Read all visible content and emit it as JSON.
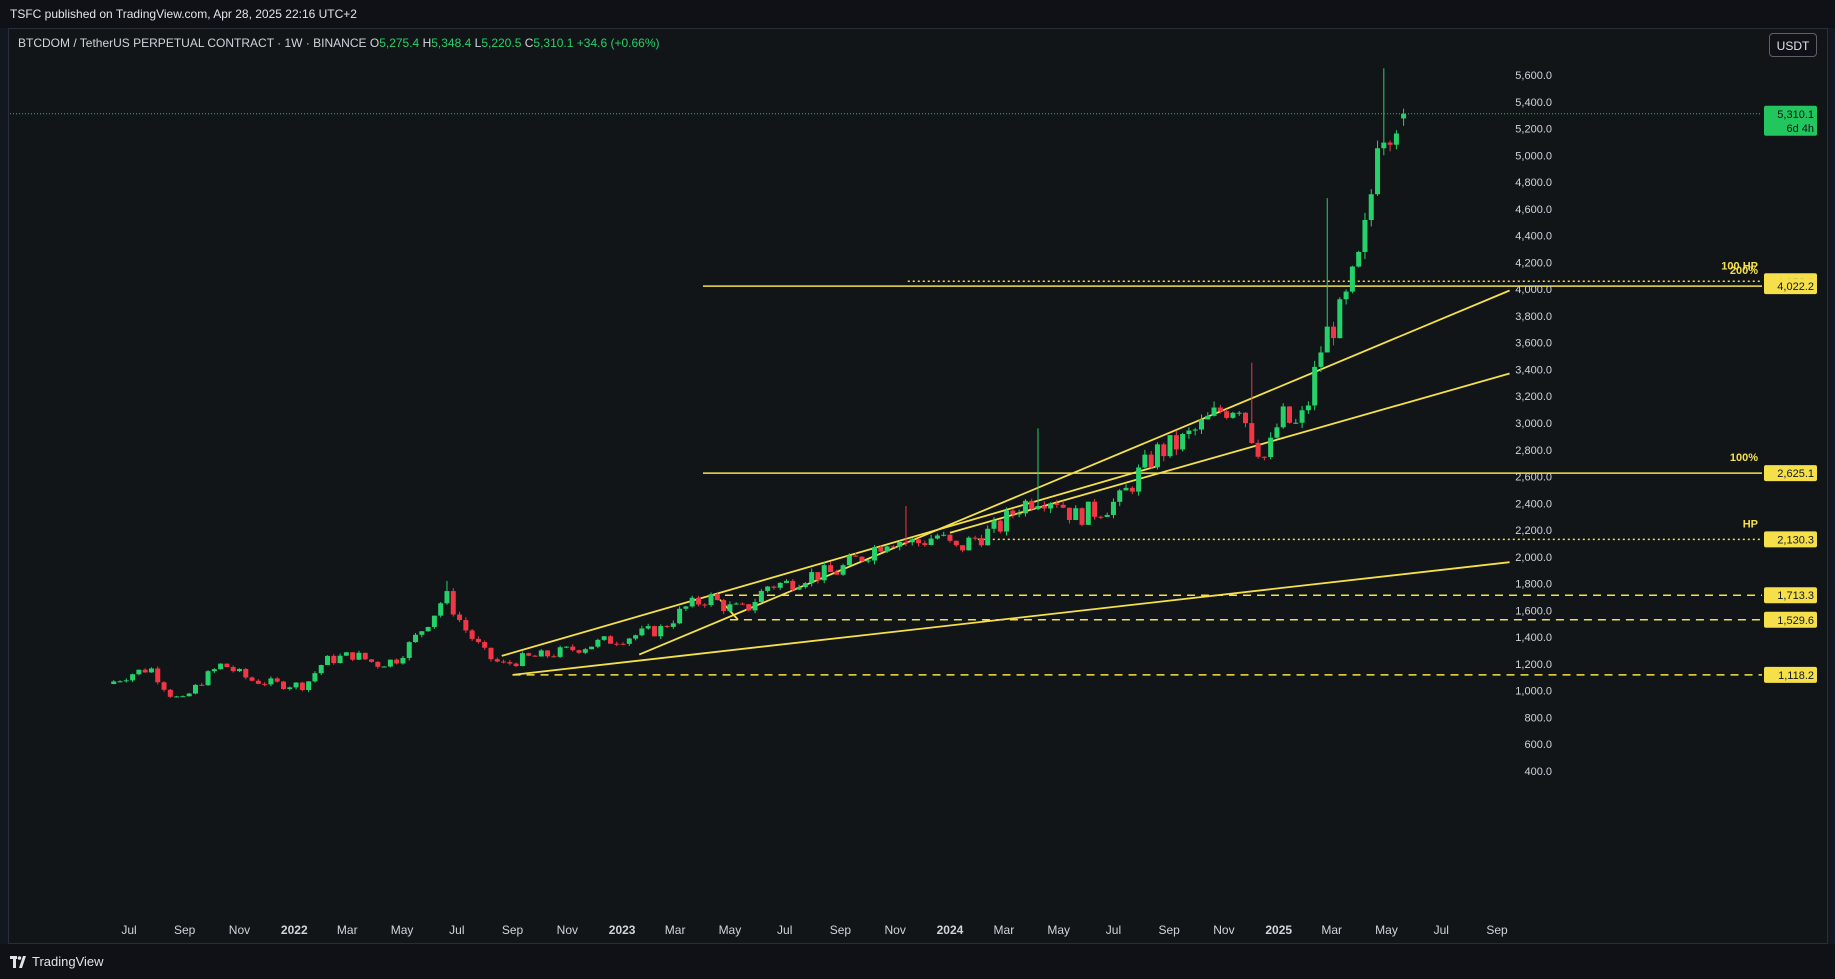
{
  "header": {
    "published_text": "TSFC published on TradingView.com, Apr 28, 2025 22:16 UTC+2"
  },
  "legend": {
    "symbol": "BTCDOM / TetherUS PERPETUAL CONTRACT · 1W · BINANCE",
    "open_label": "O",
    "open": "5,275.4",
    "high_label": "H",
    "high": "5,348.4",
    "low_label": "L",
    "low": "5,220.5",
    "close_label": "C",
    "close": "5,310.1",
    "change": "+34.6 (+0.66%)"
  },
  "currency_button": "USDT",
  "footer": {
    "brand": "TradingView"
  },
  "colors": {
    "background": "#111518",
    "up": "#26d06a",
    "down": "#f23645",
    "drawing": "#f5e04a",
    "price_tag": "#22c55e"
  },
  "chart_data": {
    "type": "candlestick",
    "interval": "1W",
    "grid": false,
    "ylim": [
      300,
      5820
    ],
    "y_ticks": [
      "400.0",
      "600.0",
      "800.0",
      "1,000.0",
      "1,200.0",
      "1,400.0",
      "1,600.0",
      "1,800.0",
      "2,000.0",
      "2,200.0",
      "2,400.0",
      "2,600.0",
      "2,800.0",
      "3,000.0",
      "3,200.0",
      "3,400.0",
      "3,600.0",
      "3,800.0",
      "4,000.0",
      "4,200.0",
      "4,400.0",
      "4,600.0",
      "4,800.0",
      "5,000.0",
      "5,200.0",
      "5,400.0",
      "5,600.0"
    ],
    "x_ticks": [
      {
        "label": "Jul",
        "date": "2021-07-01",
        "bold": false
      },
      {
        "label": "Sep",
        "date": "2021-09-01",
        "bold": false
      },
      {
        "label": "Nov",
        "date": "2021-11-01",
        "bold": false
      },
      {
        "label": "2022",
        "date": "2022-01-01",
        "bold": true
      },
      {
        "label": "Mar",
        "date": "2022-03-01",
        "bold": false
      },
      {
        "label": "May",
        "date": "2022-05-01",
        "bold": false
      },
      {
        "label": "Jul",
        "date": "2022-07-01",
        "bold": false
      },
      {
        "label": "Sep",
        "date": "2022-09-01",
        "bold": false
      },
      {
        "label": "Nov",
        "date": "2022-11-01",
        "bold": false
      },
      {
        "label": "2023",
        "date": "2023-01-01",
        "bold": true
      },
      {
        "label": "Mar",
        "date": "2023-03-01",
        "bold": false
      },
      {
        "label": "May",
        "date": "2023-05-01",
        "bold": false
      },
      {
        "label": "Jul",
        "date": "2023-07-01",
        "bold": false
      },
      {
        "label": "Sep",
        "date": "2023-09-01",
        "bold": false
      },
      {
        "label": "Nov",
        "date": "2023-11-01",
        "bold": false
      },
      {
        "label": "2024",
        "date": "2024-01-01",
        "bold": true
      },
      {
        "label": "Mar",
        "date": "2024-03-01",
        "bold": false
      },
      {
        "label": "May",
        "date": "2024-05-01",
        "bold": false
      },
      {
        "label": "Jul",
        "date": "2024-07-01",
        "bold": false
      },
      {
        "label": "Sep",
        "date": "2024-09-01",
        "bold": false
      },
      {
        "label": "Nov",
        "date": "2024-11-01",
        "bold": false
      },
      {
        "label": "2025",
        "date": "2025-01-01",
        "bold": true
      },
      {
        "label": "Mar",
        "date": "2025-03-01",
        "bold": false
      },
      {
        "label": "May",
        "date": "2025-05-01",
        "bold": false
      },
      {
        "label": "Jul",
        "date": "2025-07-01",
        "bold": false
      },
      {
        "label": "Sep",
        "date": "2025-09-01",
        "bold": false
      }
    ],
    "path_keypoints": [
      {
        "date": "2021-06-14",
        "value": 1050
      },
      {
        "date": "2021-07-12",
        "value": 1130
      },
      {
        "date": "2021-08-01",
        "value": 1170
      },
      {
        "date": "2021-08-22",
        "value": 980
      },
      {
        "date": "2021-09-05",
        "value": 920
      },
      {
        "date": "2021-10-01",
        "value": 1100
      },
      {
        "date": "2021-10-20",
        "value": 1200
      },
      {
        "date": "2021-11-20",
        "value": 1080
      },
      {
        "date": "2021-12-20",
        "value": 1050
      },
      {
        "date": "2022-01-20",
        "value": 1040
      },
      {
        "date": "2022-02-10",
        "value": 1220
      },
      {
        "date": "2022-03-15",
        "value": 1270
      },
      {
        "date": "2022-04-10",
        "value": 1200
      },
      {
        "date": "2022-05-01",
        "value": 1230
      },
      {
        "date": "2022-05-20",
        "value": 1370
      },
      {
        "date": "2022-06-15",
        "value": 1600
      },
      {
        "date": "2022-06-25",
        "value": 1720
      },
      {
        "date": "2022-07-15",
        "value": 1480
      },
      {
        "date": "2022-08-10",
        "value": 1260
      },
      {
        "date": "2022-08-28",
        "value": 1190
      },
      {
        "date": "2022-09-20",
        "value": 1240
      },
      {
        "date": "2022-10-20",
        "value": 1270
      },
      {
        "date": "2022-11-20",
        "value": 1320
      },
      {
        "date": "2022-12-20",
        "value": 1370
      },
      {
        "date": "2023-01-20",
        "value": 1410
      },
      {
        "date": "2023-02-20",
        "value": 1460
      },
      {
        "date": "2023-03-20",
        "value": 1620
      },
      {
        "date": "2023-04-15",
        "value": 1700
      },
      {
        "date": "2023-05-05",
        "value": 1620
      },
      {
        "date": "2023-05-25",
        "value": 1600
      },
      {
        "date": "2023-06-20",
        "value": 1790
      },
      {
        "date": "2023-07-10",
        "value": 1800
      },
      {
        "date": "2023-08-01",
        "value": 1860
      },
      {
        "date": "2023-09-01",
        "value": 1880
      },
      {
        "date": "2023-10-01",
        "value": 2000
      },
      {
        "date": "2023-11-01",
        "value": 2140
      },
      {
        "date": "2023-12-01",
        "value": 2100
      },
      {
        "date": "2023-12-25",
        "value": 2160
      },
      {
        "date": "2024-01-15",
        "value": 2050
      },
      {
        "date": "2024-02-05",
        "value": 2140
      },
      {
        "date": "2024-03-01",
        "value": 2210
      },
      {
        "date": "2024-03-25",
        "value": 2380
      },
      {
        "date": "2024-04-15",
        "value": 2450
      },
      {
        "date": "2024-05-05",
        "value": 2440
      },
      {
        "date": "2024-05-25",
        "value": 2300
      },
      {
        "date": "2024-06-20",
        "value": 2350
      },
      {
        "date": "2024-07-15",
        "value": 2420
      },
      {
        "date": "2024-08-05",
        "value": 2620
      },
      {
        "date": "2024-08-25",
        "value": 2780
      },
      {
        "date": "2024-09-20",
        "value": 2850
      },
      {
        "date": "2024-10-15",
        "value": 2980
      },
      {
        "date": "2024-11-05",
        "value": 3100
      },
      {
        "date": "2024-11-25",
        "value": 3150
      },
      {
        "date": "2024-12-10",
        "value": 2900
      },
      {
        "date": "2024-12-25",
        "value": 2720
      },
      {
        "date": "2025-01-10",
        "value": 3050
      },
      {
        "date": "2025-01-30",
        "value": 2960
      },
      {
        "date": "2025-02-12",
        "value": 3200
      },
      {
        "date": "2025-02-22",
        "value": 3520
      },
      {
        "date": "2025-03-05",
        "value": 3700
      },
      {
        "date": "2025-03-20",
        "value": 3820
      },
      {
        "date": "2025-03-30",
        "value": 4030
      },
      {
        "date": "2025-04-10",
        "value": 4250
      },
      {
        "date": "2025-04-20",
        "value": 4650
      },
      {
        "date": "2025-04-28",
        "value": 5200
      },
      {
        "date": "2025-05-10",
        "value": 5250
      },
      {
        "date": "2025-05-20",
        "value": 5310.1
      }
    ],
    "last_candle": {
      "date": "2025-05-20",
      "open": 5275.4,
      "high": 5348.4,
      "low": 5220.5,
      "close": 5310.1
    },
    "spikes": [
      {
        "date": "2022-06-22",
        "high": 1820
      },
      {
        "date": "2023-11-10",
        "high": 2380
      },
      {
        "date": "2024-04-08",
        "high": 2960
      },
      {
        "date": "2024-12-05",
        "high": 3450
      },
      {
        "date": "2025-02-24",
        "high": 4680
      },
      {
        "date": "2025-04-28",
        "high": 5650
      }
    ],
    "horizontal_levels": [
      {
        "value": 4058.6,
        "label": "4,058.6",
        "style": "dotted",
        "from": "2023-11-15",
        "annotation": "100 HP"
      },
      {
        "value": 4022.2,
        "label": "4,022.2",
        "style": "solid",
        "from": "2023-04-01",
        "annotation": "200%"
      },
      {
        "value": 2625.1,
        "label": "2,625.1",
        "style": "solid",
        "from": "2023-04-01",
        "annotation": "100%"
      },
      {
        "value": 2130.3,
        "label": "2,130.3",
        "style": "dotted",
        "from": "2024-02-01",
        "annotation": "HP"
      },
      {
        "value": 1713.3,
        "label": "1,713.3",
        "style": "dashed",
        "from": "2023-04-10",
        "annotation": ""
      },
      {
        "value": 1529.6,
        "label": "1,529.6",
        "style": "dashed",
        "from": "2023-05-01",
        "annotation": ""
      },
      {
        "value": 1118.2,
        "label": "1,118.2",
        "style": "dashed",
        "from": "2022-09-01",
        "annotation": ""
      }
    ],
    "trendlines": [
      {
        "from": {
          "date": "2022-09-01",
          "value": 1118
        },
        "to": {
          "date": "2025-09-15",
          "value": 1960
        }
      },
      {
        "from": {
          "date": "2022-08-20",
          "value": 1260
        },
        "to": {
          "date": "2024-08-20",
          "value": 2680
        }
      },
      {
        "from": {
          "date": "2023-01-20",
          "value": 1270
        },
        "to": {
          "date": "2025-09-15",
          "value": 3990
        }
      },
      {
        "from": {
          "date": "2024-01-01",
          "value": 2180
        },
        "to": {
          "date": "2025-09-15",
          "value": 3370
        }
      },
      {
        "from": {
          "date": "2023-04-20",
          "value": 1680
        },
        "to": {
          "date": "2023-05-10",
          "value": 1530
        }
      }
    ],
    "current_price": {
      "value": 5310.1,
      "label": "5,310.1",
      "countdown": "6d 4h"
    }
  }
}
